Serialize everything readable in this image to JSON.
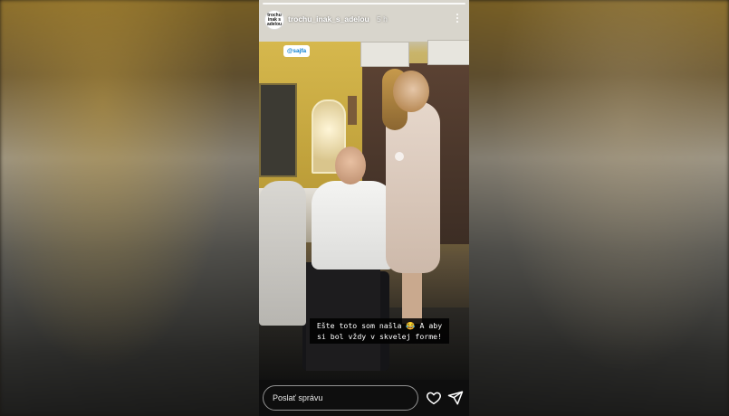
{
  "story": {
    "username": "trochu_inak_s_adelou",
    "time_ago": "5 h",
    "avatar_text": "trochu inak s adelou",
    "mention_tag": "@sajfa",
    "caption": "Ešte toto som našla 😂 A aby si bol vždy v skvelej forme!"
  },
  "reply": {
    "placeholder": "Poslať správu"
  },
  "icons": {
    "more": "more-vertical-icon",
    "like": "heart-icon",
    "send": "send-icon"
  },
  "colors": {
    "background": "#1b1712",
    "mention_text": "#0a7fd1",
    "caption_bg": "#000000"
  }
}
